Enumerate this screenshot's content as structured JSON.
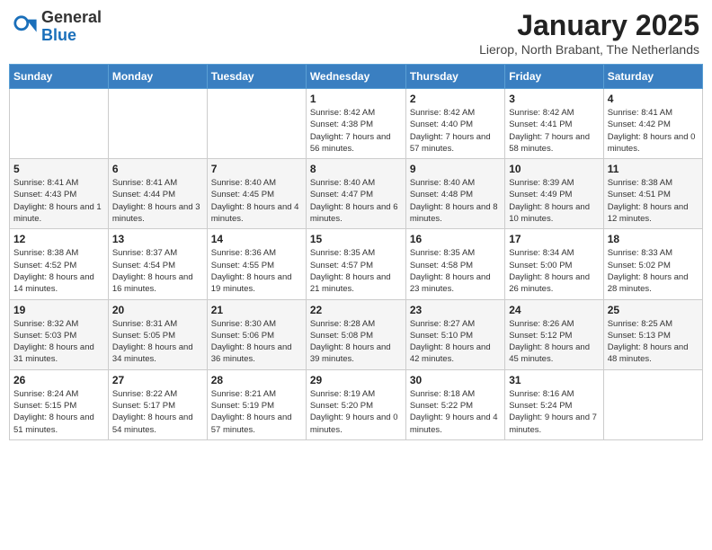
{
  "header": {
    "logo_general": "General",
    "logo_blue": "Blue",
    "month_title": "January 2025",
    "subtitle": "Lierop, North Brabant, The Netherlands"
  },
  "days_of_week": [
    "Sunday",
    "Monday",
    "Tuesday",
    "Wednesday",
    "Thursday",
    "Friday",
    "Saturday"
  ],
  "weeks": [
    {
      "days": [
        {
          "number": "",
          "info": ""
        },
        {
          "number": "",
          "info": ""
        },
        {
          "number": "",
          "info": ""
        },
        {
          "number": "1",
          "info": "Sunrise: 8:42 AM\nSunset: 4:38 PM\nDaylight: 7 hours and 56 minutes."
        },
        {
          "number": "2",
          "info": "Sunrise: 8:42 AM\nSunset: 4:40 PM\nDaylight: 7 hours and 57 minutes."
        },
        {
          "number": "3",
          "info": "Sunrise: 8:42 AM\nSunset: 4:41 PM\nDaylight: 7 hours and 58 minutes."
        },
        {
          "number": "4",
          "info": "Sunrise: 8:41 AM\nSunset: 4:42 PM\nDaylight: 8 hours and 0 minutes."
        }
      ]
    },
    {
      "days": [
        {
          "number": "5",
          "info": "Sunrise: 8:41 AM\nSunset: 4:43 PM\nDaylight: 8 hours and 1 minute."
        },
        {
          "number": "6",
          "info": "Sunrise: 8:41 AM\nSunset: 4:44 PM\nDaylight: 8 hours and 3 minutes."
        },
        {
          "number": "7",
          "info": "Sunrise: 8:40 AM\nSunset: 4:45 PM\nDaylight: 8 hours and 4 minutes."
        },
        {
          "number": "8",
          "info": "Sunrise: 8:40 AM\nSunset: 4:47 PM\nDaylight: 8 hours and 6 minutes."
        },
        {
          "number": "9",
          "info": "Sunrise: 8:40 AM\nSunset: 4:48 PM\nDaylight: 8 hours and 8 minutes."
        },
        {
          "number": "10",
          "info": "Sunrise: 8:39 AM\nSunset: 4:49 PM\nDaylight: 8 hours and 10 minutes."
        },
        {
          "number": "11",
          "info": "Sunrise: 8:38 AM\nSunset: 4:51 PM\nDaylight: 8 hours and 12 minutes."
        }
      ]
    },
    {
      "days": [
        {
          "number": "12",
          "info": "Sunrise: 8:38 AM\nSunset: 4:52 PM\nDaylight: 8 hours and 14 minutes."
        },
        {
          "number": "13",
          "info": "Sunrise: 8:37 AM\nSunset: 4:54 PM\nDaylight: 8 hours and 16 minutes."
        },
        {
          "number": "14",
          "info": "Sunrise: 8:36 AM\nSunset: 4:55 PM\nDaylight: 8 hours and 19 minutes."
        },
        {
          "number": "15",
          "info": "Sunrise: 8:35 AM\nSunset: 4:57 PM\nDaylight: 8 hours and 21 minutes."
        },
        {
          "number": "16",
          "info": "Sunrise: 8:35 AM\nSunset: 4:58 PM\nDaylight: 8 hours and 23 minutes."
        },
        {
          "number": "17",
          "info": "Sunrise: 8:34 AM\nSunset: 5:00 PM\nDaylight: 8 hours and 26 minutes."
        },
        {
          "number": "18",
          "info": "Sunrise: 8:33 AM\nSunset: 5:02 PM\nDaylight: 8 hours and 28 minutes."
        }
      ]
    },
    {
      "days": [
        {
          "number": "19",
          "info": "Sunrise: 8:32 AM\nSunset: 5:03 PM\nDaylight: 8 hours and 31 minutes."
        },
        {
          "number": "20",
          "info": "Sunrise: 8:31 AM\nSunset: 5:05 PM\nDaylight: 8 hours and 34 minutes."
        },
        {
          "number": "21",
          "info": "Sunrise: 8:30 AM\nSunset: 5:06 PM\nDaylight: 8 hours and 36 minutes."
        },
        {
          "number": "22",
          "info": "Sunrise: 8:28 AM\nSunset: 5:08 PM\nDaylight: 8 hours and 39 minutes."
        },
        {
          "number": "23",
          "info": "Sunrise: 8:27 AM\nSunset: 5:10 PM\nDaylight: 8 hours and 42 minutes."
        },
        {
          "number": "24",
          "info": "Sunrise: 8:26 AM\nSunset: 5:12 PM\nDaylight: 8 hours and 45 minutes."
        },
        {
          "number": "25",
          "info": "Sunrise: 8:25 AM\nSunset: 5:13 PM\nDaylight: 8 hours and 48 minutes."
        }
      ]
    },
    {
      "days": [
        {
          "number": "26",
          "info": "Sunrise: 8:24 AM\nSunset: 5:15 PM\nDaylight: 8 hours and 51 minutes."
        },
        {
          "number": "27",
          "info": "Sunrise: 8:22 AM\nSunset: 5:17 PM\nDaylight: 8 hours and 54 minutes."
        },
        {
          "number": "28",
          "info": "Sunrise: 8:21 AM\nSunset: 5:19 PM\nDaylight: 8 hours and 57 minutes."
        },
        {
          "number": "29",
          "info": "Sunrise: 8:19 AM\nSunset: 5:20 PM\nDaylight: 9 hours and 0 minutes."
        },
        {
          "number": "30",
          "info": "Sunrise: 8:18 AM\nSunset: 5:22 PM\nDaylight: 9 hours and 4 minutes."
        },
        {
          "number": "31",
          "info": "Sunrise: 8:16 AM\nSunset: 5:24 PM\nDaylight: 9 hours and 7 minutes."
        },
        {
          "number": "",
          "info": ""
        }
      ]
    }
  ]
}
